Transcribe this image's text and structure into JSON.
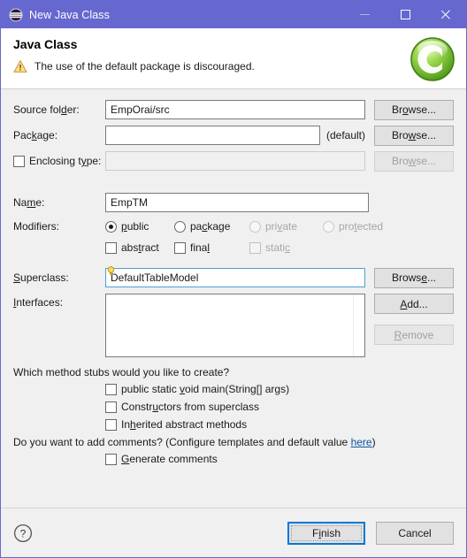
{
  "window": {
    "title": "New Java Class",
    "icon": "java-class-icon",
    "minimize_label": "Minimize",
    "maximize_label": "Maximize",
    "close_label": "Close"
  },
  "banner": {
    "title": "Java Class",
    "message": "The use of the default package is discouraged.",
    "warn_icon": "warning-triangle-icon",
    "logo_icon": "green-class-c-icon",
    "accent_color": "#6667cf",
    "warn_color": "#f0c040",
    "logo_color": "#77c23c"
  },
  "form": {
    "source_folder": {
      "label": "Source folder:",
      "label_pre": "Source fol",
      "label_key": "d",
      "label_post": "er:",
      "value": "EmpOrai/src",
      "browse": {
        "pre": "Br",
        "key": "o",
        "post": "wse...",
        "text": "Browse..."
      }
    },
    "package": {
      "label": "Package:",
      "label_pre": "Pac",
      "label_key": "k",
      "label_post": "age:",
      "value": "",
      "default_note": "(default)",
      "browse": {
        "pre": "Bro",
        "key": "w",
        "post": "se...",
        "text": "Browse..."
      }
    },
    "enclosing_type": {
      "label": "Enclosing type:",
      "label_pre": "Enclosing t",
      "label_key": "y",
      "label_post": "pe:",
      "checked": false,
      "value": "",
      "disabled": true,
      "browse": {
        "pre": "Bro",
        "key": "w",
        "post": "se...",
        "text": "Browse..."
      }
    },
    "name": {
      "label": "Name:",
      "label_pre": "Na",
      "label_key": "m",
      "label_post": "e:",
      "value": "EmpTM"
    },
    "modifiers": {
      "label": "Modifiers:",
      "access": [
        {
          "label": "public",
          "pre": "",
          "key": "p",
          "post": "ublic",
          "checked": true,
          "disabled": false
        },
        {
          "label": "package",
          "pre": "pa",
          "key": "c",
          "post": "kage",
          "checked": false,
          "disabled": false
        },
        {
          "label": "private",
          "pre": "pri",
          "key": "v",
          "post": "ate",
          "checked": false,
          "disabled": true
        },
        {
          "label": "protected",
          "pre": "pro",
          "key": "t",
          "post": "ected",
          "checked": false,
          "disabled": true
        }
      ],
      "flags": [
        {
          "label": "abstract",
          "pre": "abs",
          "key": "t",
          "post": "ract",
          "checked": false,
          "disabled": false
        },
        {
          "label": "final",
          "pre": "fina",
          "key": "l",
          "post": "",
          "checked": false,
          "disabled": false
        },
        {
          "label": "static",
          "pre": "stati",
          "key": "c",
          "post": "",
          "checked": false,
          "disabled": true
        }
      ]
    },
    "superclass": {
      "label": "Superclass:",
      "label_pre": "",
      "label_key": "S",
      "label_post": "uperclass:",
      "value": "DefaultTableModel",
      "focused": true,
      "hint_icon": "lightbulb-content-assist-icon",
      "browse": {
        "pre": "Brows",
        "key": "e",
        "post": "...",
        "text": "Browse..."
      }
    },
    "interfaces": {
      "label": "Interfaces:",
      "label_pre": "",
      "label_key": "I",
      "label_post": "nterfaces:",
      "items": [],
      "add": {
        "pre": "",
        "key": "A",
        "post": "dd...",
        "text": "Add..."
      },
      "remove": {
        "pre": "",
        "key": "R",
        "post": "emove",
        "text": "Remove",
        "disabled": true
      }
    }
  },
  "stubs": {
    "question": "Which method stubs would you like to create?",
    "options": [
      {
        "label": "public static void main(String[] args)",
        "pre": "public static ",
        "key": "v",
        "post": "oid main(String[] args)",
        "checked": false
      },
      {
        "label": "Constructors from superclass",
        "pre": "Constr",
        "key": "u",
        "post": "ctors from superclass",
        "checked": false
      },
      {
        "label": "Inherited abstract methods",
        "pre": "In",
        "key": "h",
        "post": "erited abstract methods",
        "checked": false
      }
    ]
  },
  "comments": {
    "question_pre": "Do you want to add comments? (Configure templates and default value ",
    "link": "here",
    "question_post": ")",
    "option": {
      "label": "Generate comments",
      "pre": "",
      "key": "G",
      "post": "enerate comments",
      "checked": false
    }
  },
  "footer": {
    "help_icon": "help-question-icon",
    "finish": {
      "pre": "F",
      "key": "i",
      "post": "nish",
      "text": "Finish",
      "is_default": true
    },
    "cancel": {
      "text": "Cancel"
    }
  }
}
